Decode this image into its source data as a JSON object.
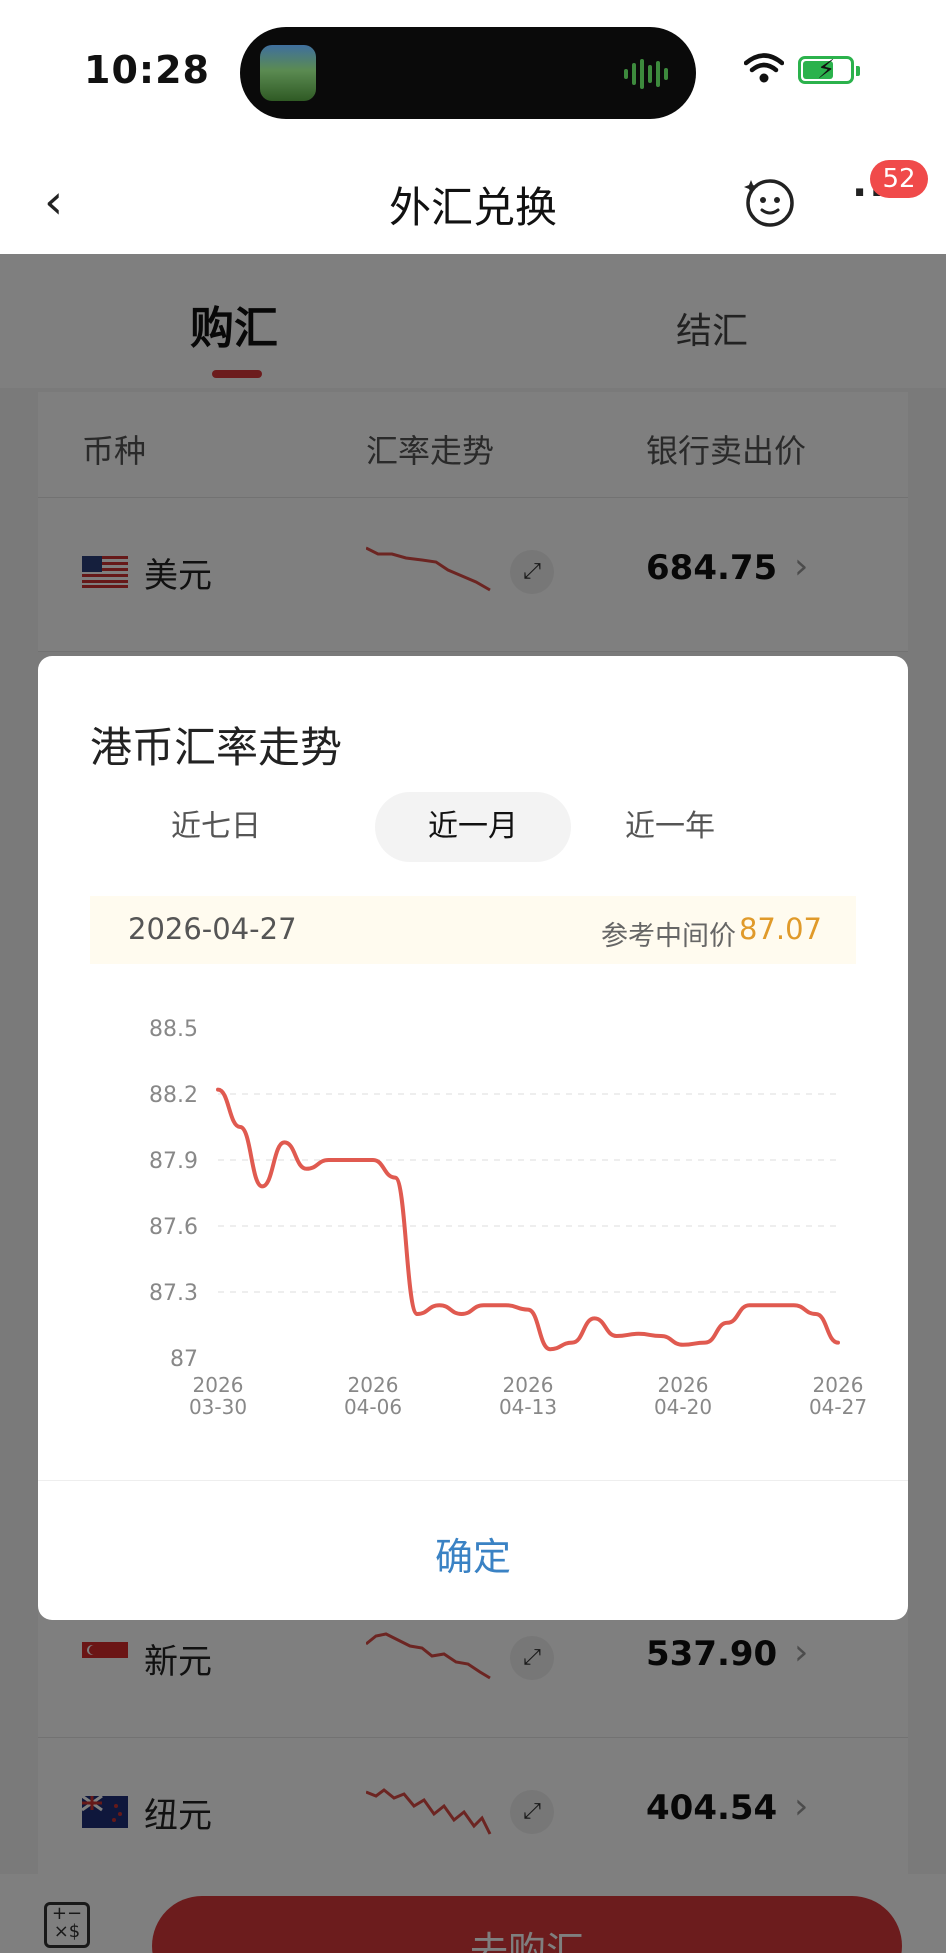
{
  "status": {
    "time": "10:28"
  },
  "nav": {
    "title": "外汇兑换",
    "badge": "52"
  },
  "tabs": {
    "buy": "购汇",
    "sell": "结汇"
  },
  "table": {
    "headers": [
      "币种",
      "汇率走势",
      "银行卖出价"
    ],
    "rows": [
      {
        "currency": "美元",
        "flag": "us-flag-icon",
        "price": "684.75"
      },
      {
        "currency": "新元",
        "flag": "sg-flag-icon",
        "price": "537.90"
      },
      {
        "currency": "纽元",
        "flag": "nz-flag-icon",
        "price": "404.54"
      }
    ]
  },
  "bottom": {
    "buy_button": "去购汇"
  },
  "dialog": {
    "title": "港币汇率走势",
    "periods": [
      "近七日",
      "近一月",
      "近一年"
    ],
    "active_period": "近一月",
    "selected_date": "2026-04-27",
    "mid_label": "参考中间价",
    "mid_value": "87.07",
    "confirm": "确定"
  },
  "chart_data": {
    "type": "line",
    "title": "",
    "xlabel": "",
    "ylabel": "",
    "ylim": [
      87.0,
      88.5
    ],
    "yticks": [
      "88.5",
      "88.2",
      "87.9",
      "87.6",
      "87.3",
      "87"
    ],
    "xticks": [
      {
        "date": "2026-03-30",
        "l1": "2026",
        "l2": "03-30"
      },
      {
        "date": "2026-04-06",
        "l1": "2026",
        "l2": "04-06"
      },
      {
        "date": "2026-04-13",
        "l1": "2026",
        "l2": "04-13"
      },
      {
        "date": "2026-04-20",
        "l1": "2026",
        "l2": "04-20"
      },
      {
        "date": "2026-04-27",
        "l1": "2026",
        "l2": "04-27"
      }
    ],
    "grid": true,
    "color": "#e05a50",
    "series": [
      {
        "points": [
          [
            "2026-03-30",
            88.22
          ],
          [
            "2026-03-31",
            88.05
          ],
          [
            "2026-04-01",
            87.78
          ],
          [
            "2026-04-02",
            87.98
          ],
          [
            "2026-04-03",
            87.86
          ],
          [
            "2026-04-04",
            87.9
          ],
          [
            "2026-04-05",
            87.9
          ],
          [
            "2026-04-06",
            87.9
          ],
          [
            "2026-04-07",
            87.82
          ],
          [
            "2026-04-08",
            87.2
          ],
          [
            "2026-04-09",
            87.24
          ],
          [
            "2026-04-10",
            87.2
          ],
          [
            "2026-04-11",
            87.24
          ],
          [
            "2026-04-12",
            87.24
          ],
          [
            "2026-04-13",
            87.22
          ],
          [
            "2026-04-14",
            87.04
          ],
          [
            "2026-04-15",
            87.07
          ],
          [
            "2026-04-16",
            87.18
          ],
          [
            "2026-04-17",
            87.1
          ],
          [
            "2026-04-18",
            87.11
          ],
          [
            "2026-04-19",
            87.1
          ],
          [
            "2026-04-20",
            87.06
          ],
          [
            "2026-04-21",
            87.07
          ],
          [
            "2026-04-22",
            87.16
          ],
          [
            "2026-04-23",
            87.24
          ],
          [
            "2026-04-24",
            87.24
          ],
          [
            "2026-04-25",
            87.24
          ],
          [
            "2026-04-26",
            87.2
          ],
          [
            "2026-04-27",
            87.07
          ]
        ]
      }
    ]
  }
}
